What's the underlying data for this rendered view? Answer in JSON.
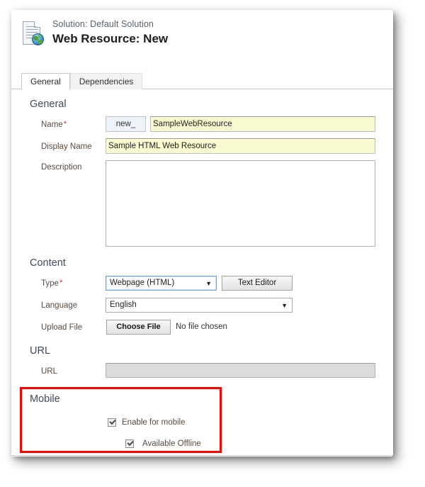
{
  "header": {
    "icon": "web-resource-document-globe-icon",
    "solution_label": "Solution: Default Solution",
    "record_title": "Web Resource: New"
  },
  "tabs": [
    {
      "label": "General",
      "active": true
    },
    {
      "label": "Dependencies",
      "active": false
    }
  ],
  "sections": {
    "general": {
      "title": "General",
      "name": {
        "label": "Name",
        "required_marker": "*",
        "prefix": "new_",
        "value": "SampleWebResource"
      },
      "display_name": {
        "label": "Display Name",
        "value": "Sample HTML Web Resource"
      },
      "description": {
        "label": "Description",
        "value": ""
      }
    },
    "content": {
      "title": "Content",
      "type": {
        "label": "Type",
        "required_marker": "*",
        "value": "Webpage (HTML)",
        "arrow": "▼"
      },
      "text_editor_button": "Text Editor",
      "language": {
        "label": "Language",
        "value": "English",
        "arrow": "▼"
      },
      "upload_file": {
        "label": "Upload File",
        "button": "Choose File",
        "status": "No file chosen"
      }
    },
    "url": {
      "title": "URL",
      "field": {
        "label": "URL",
        "value": ""
      }
    },
    "mobile": {
      "title": "Mobile",
      "highlight_color": "#ff0000",
      "enable_for_mobile": {
        "label": "Enable for mobile",
        "checked": true
      },
      "available_offline": {
        "label": "Available Offline",
        "checked": true
      }
    }
  },
  "colors": {
    "required_field_background": "#fafad0",
    "highlight_border": "#ff0000",
    "section_heading": "#3f4b5b",
    "label": "#5a4a3f",
    "required_asterisk": "#e01b24"
  }
}
